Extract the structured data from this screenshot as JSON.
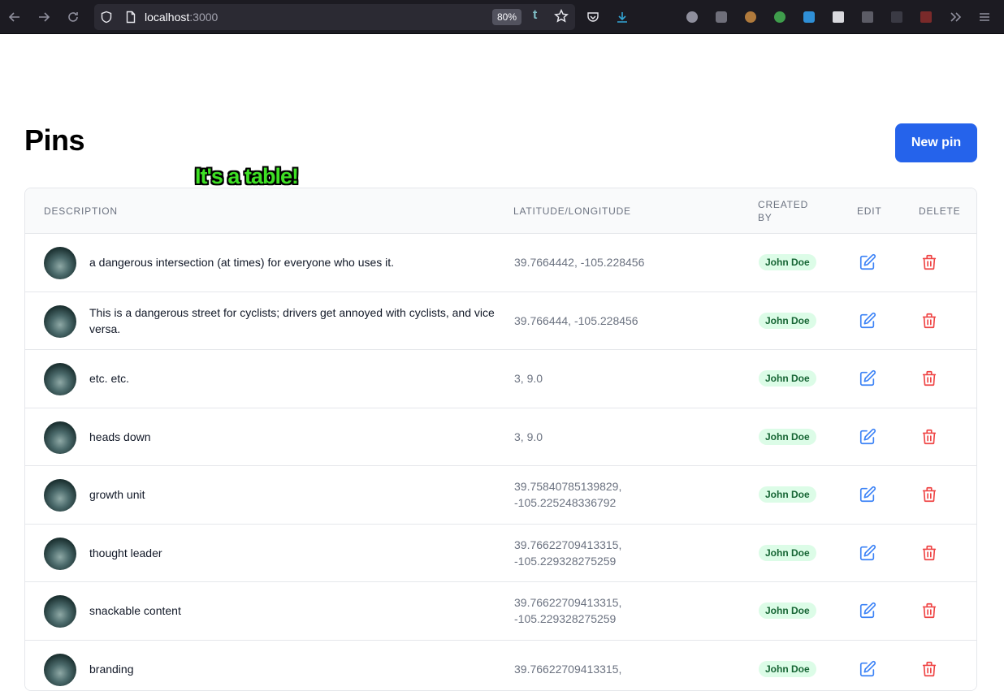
{
  "browser": {
    "url_host": "localhost",
    "url_port": ":3000",
    "zoom": "80%",
    "t_icon": "t"
  },
  "page": {
    "title": "Pins",
    "new_pin_label": "New pin",
    "sticker": "It's a table!"
  },
  "table": {
    "headers": {
      "description": "Description",
      "latlng": "Latitude/Longitude",
      "created_by": "Created by",
      "edit": "Edit",
      "delete": "Delete"
    },
    "rows": [
      {
        "description": "a dangerous intersection (at times) for everyone who uses it.",
        "latlng": "39.7664442, -105.228456",
        "created_by": "John Doe"
      },
      {
        "description": "This is a dangerous street for cyclists; drivers get annoyed with cyclists, and vice versa.",
        "latlng": "39.766444, -105.228456",
        "created_by": "John Doe"
      },
      {
        "description": "etc. etc.",
        "latlng": "3, 9.0",
        "created_by": "John Doe"
      },
      {
        "description": "heads down",
        "latlng": "3, 9.0",
        "created_by": "John Doe"
      },
      {
        "description": "growth unit",
        "latlng": "39.75840785139829, -105.225248336792",
        "created_by": "John Doe"
      },
      {
        "description": "thought leader",
        "latlng": "39.76622709413315, -105.229328275259",
        "created_by": "John Doe"
      },
      {
        "description": "snackable content",
        "latlng": "39.76622709413315, -105.229328275259",
        "created_by": "John Doe"
      },
      {
        "description": "branding",
        "latlng": "39.76622709413315,",
        "created_by": "John Doe"
      }
    ]
  },
  "colors": {
    "primary_button": "#2563eb",
    "edit_icon": "#3b82f6",
    "delete_icon": "#ef4444",
    "badge_bg": "#dcfce7",
    "badge_text": "#166534",
    "sticker": "#3ee024"
  }
}
